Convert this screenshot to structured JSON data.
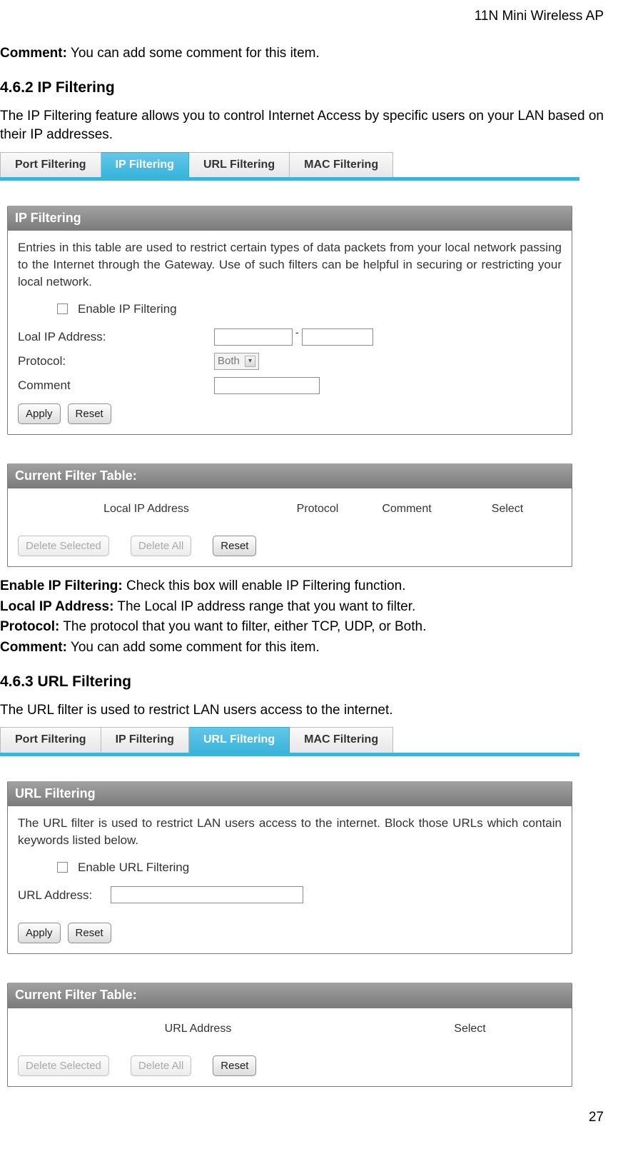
{
  "header": {
    "title": "11N Mini Wireless AP"
  },
  "intro": {
    "comment_label": "Comment:",
    "comment_text": "You can add some comment for this item."
  },
  "section_ip": {
    "heading": "4.6.2 IP Filtering",
    "intro": "The IP Filtering feature allows you to control Internet Access by specific users on your LAN based on their IP addresses.",
    "tabs": [
      "Port Filtering",
      "IP Filtering",
      "URL Filtering",
      "MAC Filtering"
    ],
    "active_tab": 1,
    "panel1": {
      "title": "IP Filtering",
      "desc": "Entries in this table are used to restrict certain types of data packets from your local network passing to the Internet through the Gateway. Use of such filters can be helpful in securing or restricting your local network.",
      "enable_label": "Enable IP Filtering",
      "row_ip_label": "Loal IP Address:",
      "row_proto_label": "Protocol:",
      "proto_selected": "Both",
      "row_comment_label": "Comment",
      "btn_apply": "Apply",
      "btn_reset": "Reset"
    },
    "panel2": {
      "title": "Current Filter Table:",
      "cols": [
        "Local IP Address",
        "Protocol",
        "Comment",
        "Select"
      ],
      "btn_delete_sel": "Delete Selected",
      "btn_delete_all": "Delete All",
      "btn_reset": "Reset"
    },
    "defs": [
      {
        "label": "Enable IP Filtering:",
        "text": "Check this box will enable IP Filtering function."
      },
      {
        "label": "Local IP Address:",
        "text": "The Local IP address range that you want to filter."
      },
      {
        "label": "Protocol:",
        "text": "The protocol that you want to filter, either TCP, UDP, or Both."
      },
      {
        "label": "Comment:",
        "text": "You can add some comment for this item."
      }
    ]
  },
  "section_url": {
    "heading": "4.6.3 URL Filtering",
    "intro": "The URL filter is used to restrict LAN users access to the internet.",
    "tabs": [
      "Port Filtering",
      "IP Filtering",
      "URL Filtering",
      "MAC Filtering"
    ],
    "active_tab": 2,
    "panel1": {
      "title": "URL Filtering",
      "desc": "The URL filter is used to restrict LAN users access to the internet. Block those URLs which contain keywords listed below.",
      "enable_label": "Enable URL Filtering",
      "row_url_label": "URL Address:",
      "btn_apply": "Apply",
      "btn_reset": "Reset"
    },
    "panel2": {
      "title": "Current Filter Table:",
      "cols": [
        "URL Address",
        "Select"
      ],
      "btn_delete_sel": "Delete Selected",
      "btn_delete_all": "Delete All",
      "btn_reset": "Reset"
    }
  },
  "page_number": "27"
}
